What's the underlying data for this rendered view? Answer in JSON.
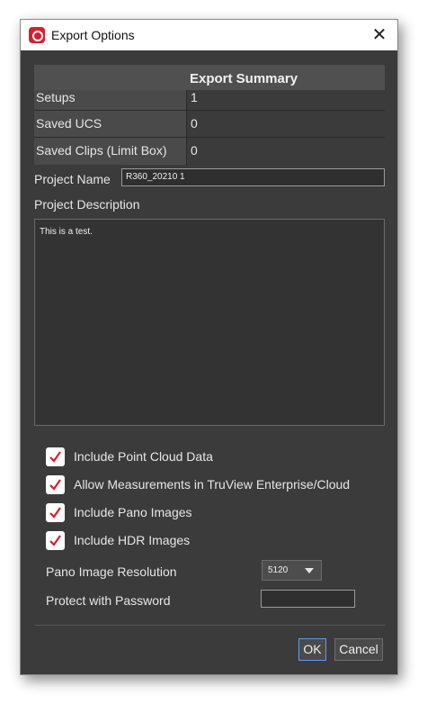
{
  "window": {
    "title": "Export Options"
  },
  "summary": {
    "header": "Export Summary",
    "rows": [
      {
        "label": "Setups",
        "value": "1"
      },
      {
        "label": "Saved UCS",
        "value": "0"
      },
      {
        "label": "Saved Clips (Limit Box)",
        "value": "0"
      }
    ]
  },
  "project": {
    "name_label": "Project Name",
    "name_value": "R360_20210 1",
    "description_label": "Project Description",
    "description_value": "This is a test."
  },
  "options": [
    {
      "label": "Include Point Cloud Data",
      "checked": true
    },
    {
      "label": "Allow Measurements in TruView Enterprise/Cloud",
      "checked": true
    },
    {
      "label": "Include Pano Images",
      "checked": true
    },
    {
      "label": "Include HDR Images",
      "checked": true
    }
  ],
  "pano_resolution": {
    "label": "Pano Image Resolution",
    "value": "5120"
  },
  "password": {
    "label": "Protect with Password",
    "value": ""
  },
  "buttons": {
    "ok": "OK",
    "cancel": "Cancel"
  },
  "colors": {
    "check": "#d4202f",
    "brand": "#d4202f",
    "ok_focus": "#5b9ee8"
  }
}
